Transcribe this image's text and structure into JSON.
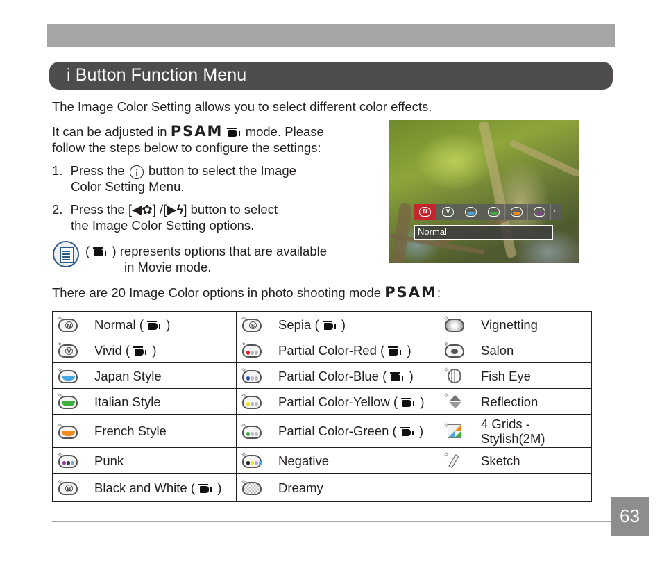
{
  "header": {
    "section_title": "i Button Function Menu"
  },
  "intro": "The Image Color Setting allows you to select different color effects.",
  "adjust": {
    "prefix": "It can be adjusted in",
    "modes": "PSAM",
    "suffix": "mode. Please",
    "line2": "follow the steps below to configure the settings:"
  },
  "steps": [
    {
      "num": "1.",
      "line1_pre": "Press the",
      "button_glyph": "i",
      "line1_post": "button to select the Image",
      "line2": "Color Setting Menu."
    },
    {
      "num": "2.",
      "line1_pre": "Press the [",
      "left_glyph": "◀✿",
      "mid": "] /[",
      "right_glyph": "▶ϟ",
      "line1_post": "] button to select",
      "line2": "the Image Color Setting options."
    }
  ],
  "note": {
    "icon": "note-icon",
    "open_paren": "(",
    "close_paren": ")",
    "line1": "represents options that are available",
    "line2": "in Movie mode."
  },
  "camera_preview": {
    "selected_index": 0,
    "strip_icons": [
      {
        "name": "normal",
        "letter": "N",
        "fill": ""
      },
      {
        "name": "vivid",
        "letter": "V",
        "fill": ""
      },
      {
        "name": "japan-style",
        "letter": "",
        "fill": "#4aa6e0"
      },
      {
        "name": "italian-style",
        "letter": "",
        "fill": "#3dae3b"
      },
      {
        "name": "french-style",
        "letter": "",
        "fill": "#f08a1c"
      },
      {
        "name": "punk",
        "letter": "",
        "fill": "#8d3fa0"
      }
    ],
    "more_glyph": "›",
    "selected_label": "Normal",
    "accent_color": "#c4262e"
  },
  "count_line": {
    "text": "There are 20 Image Color options in photo shooting mode",
    "modes": "PSAM",
    "colon": ":"
  },
  "options_table": {
    "rows": [
      [
        {
          "label": "Normal (",
          "movie": true,
          "icon": "normal-icon",
          "letter": "N"
        },
        {
          "label": "Sepia (",
          "movie": true,
          "icon": "sepia-icon",
          "letter": "S"
        },
        {
          "label": "Vignetting",
          "movie": false,
          "icon": "vignetting-icon"
        }
      ],
      [
        {
          "label": "Vivid (",
          "movie": true,
          "icon": "vivid-icon",
          "letter": "V"
        },
        {
          "label": "Partial Color-Red (",
          "movie": true,
          "icon": "partial-color-red-icon",
          "dot": "#e21b23"
        },
        {
          "label": "Salon",
          "movie": false,
          "icon": "salon-icon"
        }
      ],
      [
        {
          "label": "Japan Style",
          "movie": false,
          "icon": "japan-style-icon",
          "fill": "#4aa6e0"
        },
        {
          "label": "Partial Color-Blue (",
          "movie": true,
          "icon": "partial-color-blue-icon",
          "dot": "#2952a3"
        },
        {
          "label": "Fish Eye",
          "movie": false,
          "icon": "fish-eye-icon"
        }
      ],
      [
        {
          "label": "Italian Style",
          "movie": false,
          "icon": "italian-style-icon",
          "fill": "#3dae3b"
        },
        {
          "label": "Partial Color-Yellow (",
          "movie": true,
          "icon": "partial-color-yellow-icon",
          "dot": "#f2e51c"
        },
        {
          "label": "Reflection",
          "movie": false,
          "icon": "reflection-icon"
        }
      ],
      [
        {
          "label": "French Style",
          "movie": false,
          "icon": "french-style-icon",
          "fill": "#f08a1c"
        },
        {
          "label": "Partial Color-Green (",
          "movie": true,
          "icon": "partial-color-green-icon",
          "dot": "#3dae3b"
        },
        {
          "label": "4 Grids -\nStylish(2M)",
          "label_line1": "4 Grids -",
          "label_line2": "Stylish(2M)",
          "movie": false,
          "icon": "four-grids-icon"
        }
      ],
      [
        {
          "label": "Punk",
          "movie": false,
          "icon": "punk-icon"
        },
        {
          "label": "Negative",
          "movie": false,
          "icon": "negative-icon"
        },
        {
          "label": "Sketch",
          "movie": false,
          "icon": "sketch-icon"
        }
      ],
      [
        {
          "label": "Black and White (",
          "movie": true,
          "icon": "black-and-white-icon",
          "letter": "B"
        },
        {
          "label": "Dreamy",
          "movie": false,
          "icon": "dreamy-icon"
        },
        {
          "label": "",
          "movie": false,
          "icon": ""
        }
      ]
    ],
    "close_paren": ")"
  },
  "footer": {
    "page_number": "63"
  }
}
